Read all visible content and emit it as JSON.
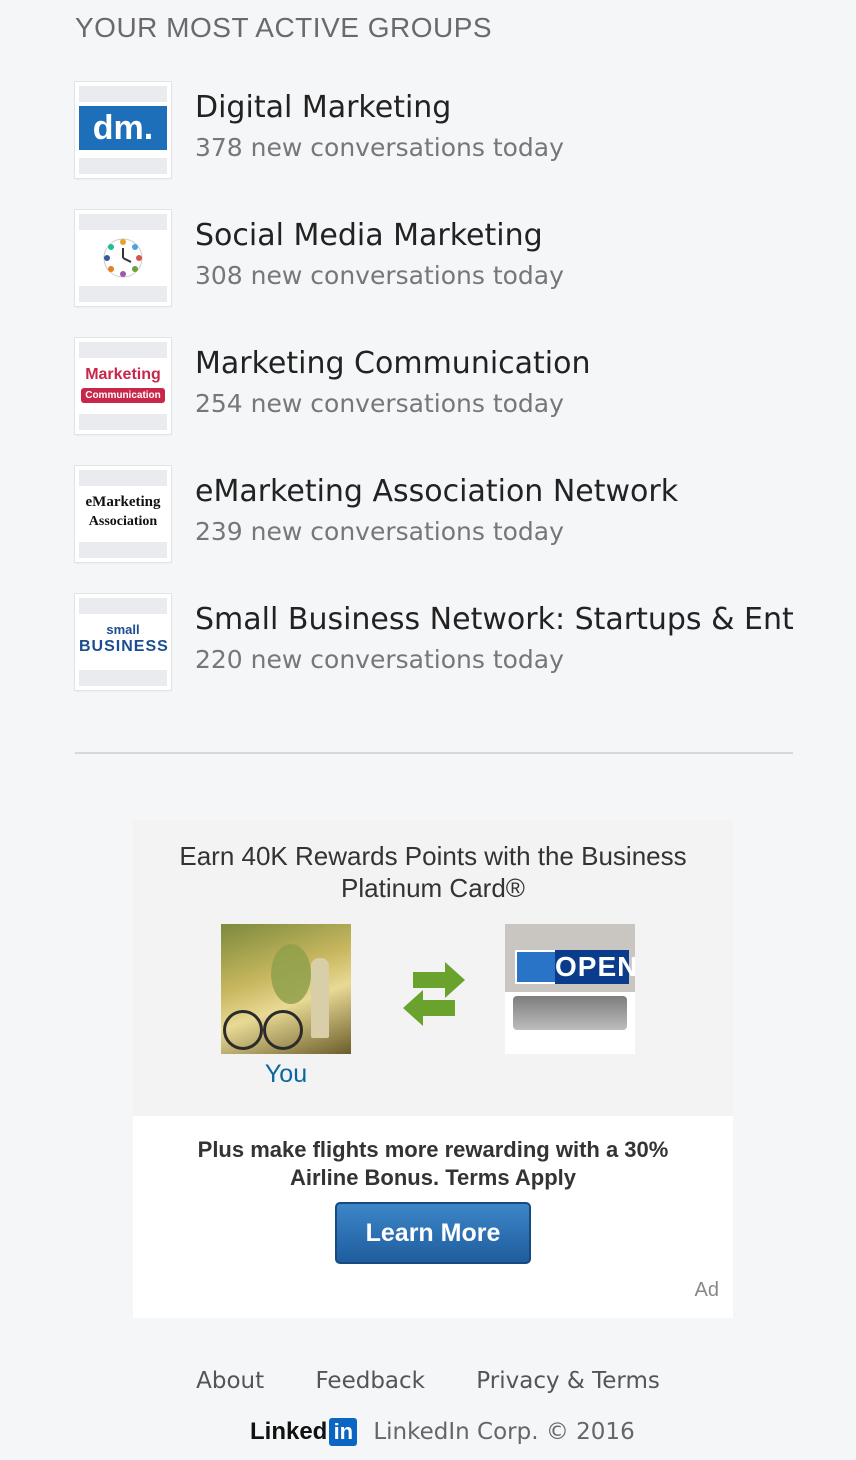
{
  "section": {
    "title": "YOUR MOST ACTIVE GROUPS"
  },
  "groups": [
    {
      "name": "Digital Marketing",
      "count": "378 new conversations today",
      "logo_text": "dm."
    },
    {
      "name": "Social Media Marketing",
      "count": "308 new conversations today"
    },
    {
      "name": "Marketing Communication",
      "count": "254 new conversations today",
      "logo_text": "Marketing",
      "logo_sub": "Communication"
    },
    {
      "name": "eMarketing Association Network",
      "count": "239 new conversations today",
      "logo_text": "eMarketing",
      "logo_sub": "Association"
    },
    {
      "name": "Small Business Network: Startups & Entrepreneurs",
      "count": "220 new conversations today",
      "logo_text": "small",
      "logo_sub": "BUSINESS"
    }
  ],
  "ad": {
    "headline": "Earn 40K Rewards Points with the Business Platinum Card®",
    "you_label": "You",
    "open_text": "OPEN",
    "subtext": "Plus make flights more rewarding with a 30% Airline Bonus. Terms Apply",
    "button_label": "Learn More",
    "ad_label": "Ad"
  },
  "footer": {
    "links": [
      "About",
      "Feedback",
      "Privacy & Terms"
    ],
    "logo_text": "Linked",
    "logo_in": "in",
    "copyright": "LinkedIn Corp. © 2016"
  },
  "colors": {
    "accent": "#0a66c2",
    "button": "#2a6fb0",
    "arrow": "#6aa22e"
  }
}
